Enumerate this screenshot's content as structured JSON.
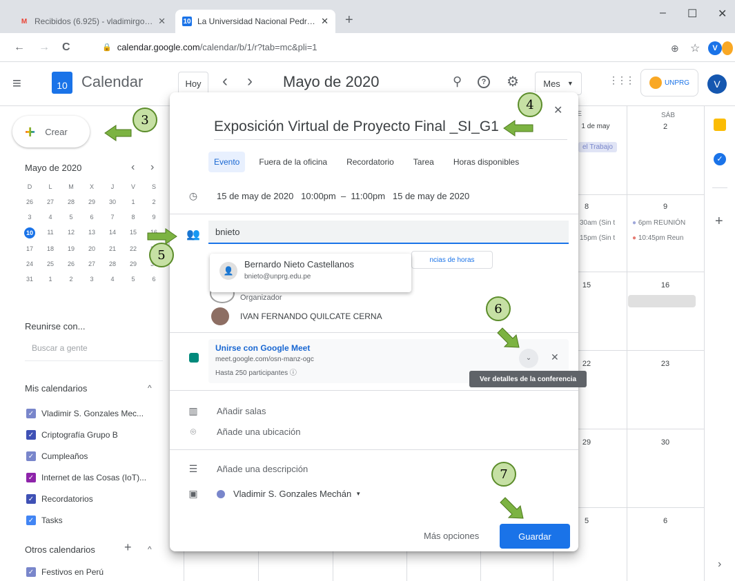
{
  "browser": {
    "tabs": [
      {
        "favicon": "M",
        "title": "Recibidos (6.925) - vladimirgonz...",
        "close": "✕"
      },
      {
        "favicon": "10",
        "title": "La Universidad Nacional Pedro R...",
        "close": "✕"
      }
    ],
    "new_tab": "+",
    "window_controls": [
      "–",
      "☐",
      "✕"
    ],
    "url_host": "calendar.google.com",
    "url_path": "/calendar/b/1/r?tab=mc&pli=1",
    "nav": {
      "back": "←",
      "forward": "→",
      "reload": "C"
    },
    "ext_avatar": "V"
  },
  "header": {
    "menu_icon": "≡",
    "logo_num": "10",
    "app_name": "Calendar",
    "today_label": "Hoy",
    "prev": "‹",
    "next": "›",
    "month_title": "Mayo de 2020",
    "view_label": "Mes",
    "apps_icon": "⋮⋮⋮",
    "org_label": "UNPRG",
    "avatar": "V"
  },
  "sidebar": {
    "create_label": "Crear",
    "mini_month": "Mayo de 2020",
    "mini_days_header": [
      "D",
      "L",
      "M",
      "X",
      "J",
      "V",
      "S"
    ],
    "mini_days": [
      "26",
      "27",
      "28",
      "29",
      "30",
      "1",
      "2",
      "3",
      "4",
      "5",
      "6",
      "7",
      "8",
      "9",
      "10",
      "11",
      "12",
      "13",
      "14",
      "15",
      "16",
      "17",
      "18",
      "19",
      "20",
      "21",
      "22",
      "23",
      "24",
      "25",
      "26",
      "27",
      "28",
      "29",
      "30",
      "31",
      "1",
      "2",
      "3",
      "4",
      "5",
      "6"
    ],
    "meet_title": "Reunirse con...",
    "search_placeholder": "Buscar a gente",
    "my_cals_title": "Mis calendarios",
    "my_cals": [
      {
        "label": "Vladimir S. Gonzales Mec...",
        "color": "#7986cb"
      },
      {
        "label": "Criptografía Grupo B",
        "color": "#3f51b5"
      },
      {
        "label": "Cumpleaños",
        "color": "#7986cb"
      },
      {
        "label": "Internet de las Cosas (IoT)...",
        "color": "#8e24aa"
      },
      {
        "label": "Recordatorios",
        "color": "#3f51b5"
      },
      {
        "label": "Tasks",
        "color": "#4285f4"
      }
    ],
    "other_cals_title": "Otros calendarios",
    "other_cals": [
      {
        "label": "Festivos en Perú",
        "color": "#7986cb"
      }
    ]
  },
  "grid": {
    "vie_label": "VIE",
    "sab_label": "SÁB",
    "vie_date": "1 de may",
    "sab_date": "2",
    "vie_chip": "el Trabajo",
    "row2_vie": "8",
    "row2_sab": "9",
    "row2_vie_ev1": "30am (Sin t",
    "row2_vie_ev2": "15pm (Sin t",
    "row2_sab_ev1": "6pm REUNIÓN",
    "row2_sab_ev2": "10:45pm Reun",
    "row3_vie": "15",
    "row3_sab": "16",
    "row4_vie": "22",
    "row4_sab": "23",
    "row5_vie": "29",
    "row5_sab": "30",
    "row6_vie": "5",
    "row6_sab": "6"
  },
  "dialog": {
    "close": "✕",
    "title": "Exposición Virtual de Proyecto Final _SI_G1",
    "tabs": [
      "Evento",
      "Fuera de la oficina",
      "Recordatorio",
      "Tarea",
      "Horas disponibles"
    ],
    "datetime": "15 de may de 2020   10:00pm  –  11:00pm   15 de may de 2020",
    "guest_input": "bnieto",
    "suggestion_name": "Bernardo Nieto Castellanos",
    "suggestion_email": "bnieto@unprg.edu.pe",
    "horas_btn": "ncias de horas",
    "organizer_label": "Organizador",
    "organizer_name": "IVAN FERNANDO QUILCATE CERNA",
    "meet_title": "Unirse con Google Meet",
    "meet_url": "meet.google.com/osn-manz-ogc",
    "meet_limit": "Hasta 250 participantes",
    "tooltip": "Ver detalles de la conferencia",
    "rooms": "Añadir salas",
    "location": "Añade una ubicación",
    "description": "Añade una descripción",
    "calendar_owner": "Vladimir S. Gonzales Mechán",
    "more_options": "Más opciones",
    "save": "Guardar"
  },
  "annotations": [
    "3",
    "4",
    "5",
    "6",
    "7"
  ],
  "colors": {
    "accent": "#1a73e8",
    "badge_fill": "#c6e0a4",
    "arrow": "#7cb342"
  }
}
